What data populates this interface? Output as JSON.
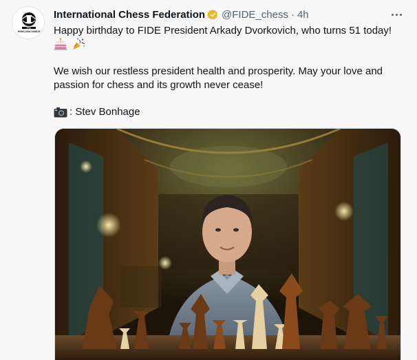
{
  "tweet": {
    "author_name": "International Chess Federation",
    "handle": "@FIDE_chess",
    "separator": "·",
    "time": "4h",
    "line1": "Happy birthday to FIDE President Arkady Dvorkovich, who turns 51 today!",
    "emojis": [
      "birthday-cake",
      "party-popper"
    ],
    "line2a": "We wish our restless president health and prosperity. May your love and",
    "line2b": "passion for chess and its growth never cease!",
    "credit": ": Stev Bonhage",
    "credit_icon": "camera-icon"
  },
  "avatar": {
    "logo_text": "FIDE",
    "motto": "GENS UNA SUMUS"
  },
  "colors": {
    "background": "#f7f7f7",
    "text_primary": "#0f1419",
    "text_secondary": "#536471",
    "verified_gold": "#e8b923"
  }
}
